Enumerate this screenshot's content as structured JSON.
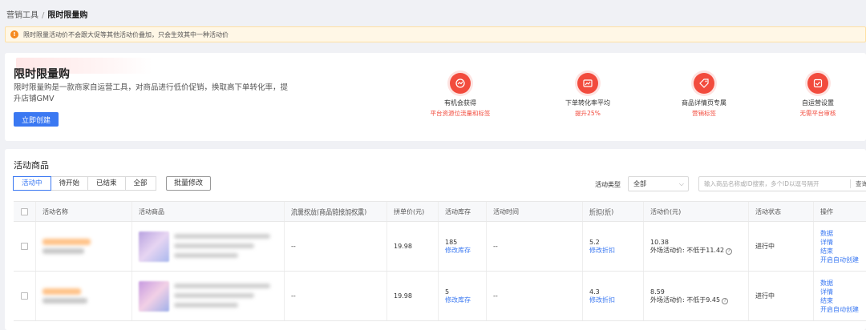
{
  "breadcrumb": {
    "parent": "营销工具",
    "separator": "/",
    "current": "限时限量购"
  },
  "notice": {
    "text": "限时限量活动价不会跟大促等其他活动价叠加，只会生效其中一种活动价"
  },
  "hero": {
    "title": "限时限量购",
    "description": "限时限量购是一款商家自运营工具，对商品进行低价促销，换取高下单转化率，提升店铺GMV",
    "create_button": "立即创建",
    "features": [
      {
        "icon": "chart-icon",
        "name": "有机会获得",
        "sub": "平台资源位流量和标签"
      },
      {
        "icon": "trend-icon",
        "name": "下单转化率平均",
        "sub": "提升25%"
      },
      {
        "icon": "tag-icon",
        "name": "商品详情页专属",
        "sub": "营销标签"
      },
      {
        "icon": "check-icon",
        "name": "自运营设置",
        "sub": "无需平台审核"
      }
    ]
  },
  "panel": {
    "title": "活动商品",
    "tabs": [
      "活动中",
      "待开始",
      "已结束",
      "全部"
    ],
    "active_tab": "活动中",
    "batch_button": "批量修改",
    "type_label": "活动类型",
    "type_value": "全部",
    "search_placeholder": "输入商品名称或ID搜索，多个ID以逗号隔开",
    "search_query": "查询"
  },
  "table": {
    "headers": {
      "name": "活动名称",
      "product": "活动商品",
      "traffic": "流量权益(商品链接加权重)",
      "price": "拼单价(元)",
      "stock": "活动库存",
      "time": "活动时间",
      "discount": "折扣(折)",
      "activity_price": "活动价(元)",
      "status": "活动状态",
      "actions": "操作"
    },
    "rows": [
      {
        "traffic": "--",
        "price": "19.98",
        "stock": "185",
        "stock_action": "修改库存",
        "time": "--",
        "discount": "5.2",
        "discount_action": "修改折扣",
        "activity_price": "10.38",
        "external_price": "外场活动价: 不低于11.42",
        "status": "进行中",
        "actions": [
          "数据",
          "详情",
          "结束",
          "开启自动创建"
        ]
      },
      {
        "traffic": "--",
        "price": "19.98",
        "stock": "5",
        "stock_action": "修改库存",
        "time": "--",
        "discount": "4.3",
        "discount_action": "修改折扣",
        "activity_price": "8.59",
        "external_price": "外场活动价: 不低于9.45",
        "status": "进行中",
        "actions": [
          "数据",
          "详情",
          "结束",
          "开启自动创建"
        ]
      }
    ]
  },
  "colors": {
    "accent": "#3a78f2",
    "brand_red": "#f24b3d",
    "warning": "#f5891f"
  }
}
